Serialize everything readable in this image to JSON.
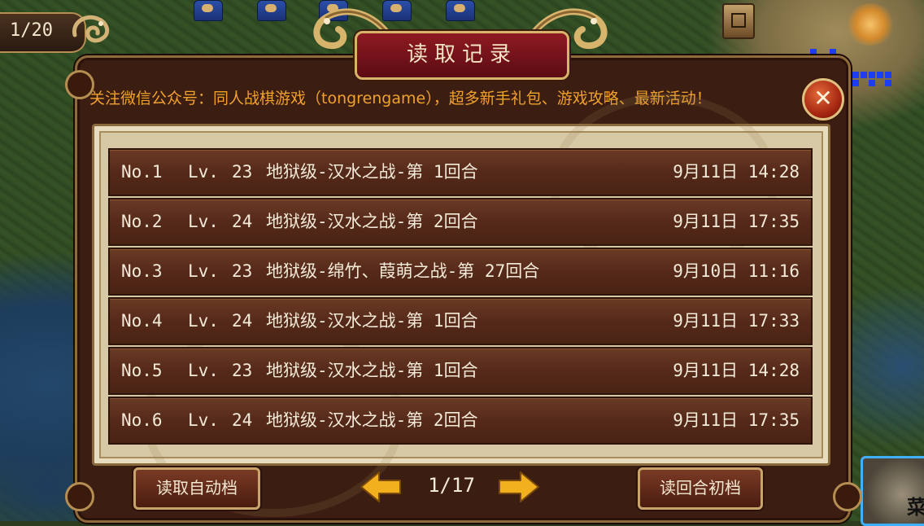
{
  "hud": {
    "save_counter": "1/20"
  },
  "dialog": {
    "title": "读取记录",
    "notice": "关注微信公众号：同人战棋游戏（tongrengame），超多新手礼包、游戏攻略、最新活动！",
    "close_label": "✕",
    "saves": [
      {
        "no": "No.1",
        "lv_label": "Lv.",
        "lv": "23",
        "stage": "地狱级-汉水之战-第 1回合",
        "date": "9月11日 14:28"
      },
      {
        "no": "No.2",
        "lv_label": "Lv.",
        "lv": "24",
        "stage": "地狱级-汉水之战-第 2回合",
        "date": "9月11日 17:35"
      },
      {
        "no": "No.3",
        "lv_label": "Lv.",
        "lv": "23",
        "stage": "地狱级-绵竹、葭萌之战-第 27回合",
        "date": "9月10日 11:16"
      },
      {
        "no": "No.4",
        "lv_label": "Lv.",
        "lv": "24",
        "stage": "地狱级-汉水之战-第 1回合",
        "date": "9月11日 17:33"
      },
      {
        "no": "No.5",
        "lv_label": "Lv.",
        "lv": "23",
        "stage": "地狱级-汉水之战-第 1回合",
        "date": "9月11日 14:28"
      },
      {
        "no": "No.6",
        "lv_label": "Lv.",
        "lv": "24",
        "stage": "地狱级-汉水之战-第 2回合",
        "date": "9月11日 17:35"
      }
    ],
    "footer": {
      "auto_save_label": "读取自动档",
      "page": "1/17",
      "turn_start_label": "读回合初档"
    }
  },
  "corner_menu_label": "菜",
  "colors": {
    "notice": "#f0a22c",
    "title_plaque": "#8e1a22",
    "row_bg": "#55291a",
    "arrow": "#f2b01e"
  },
  "icons": [
    "dragon-ornament-icon",
    "close-icon",
    "arrow-left-icon",
    "arrow-right-icon",
    "map-icon",
    "gear-icon"
  ]
}
